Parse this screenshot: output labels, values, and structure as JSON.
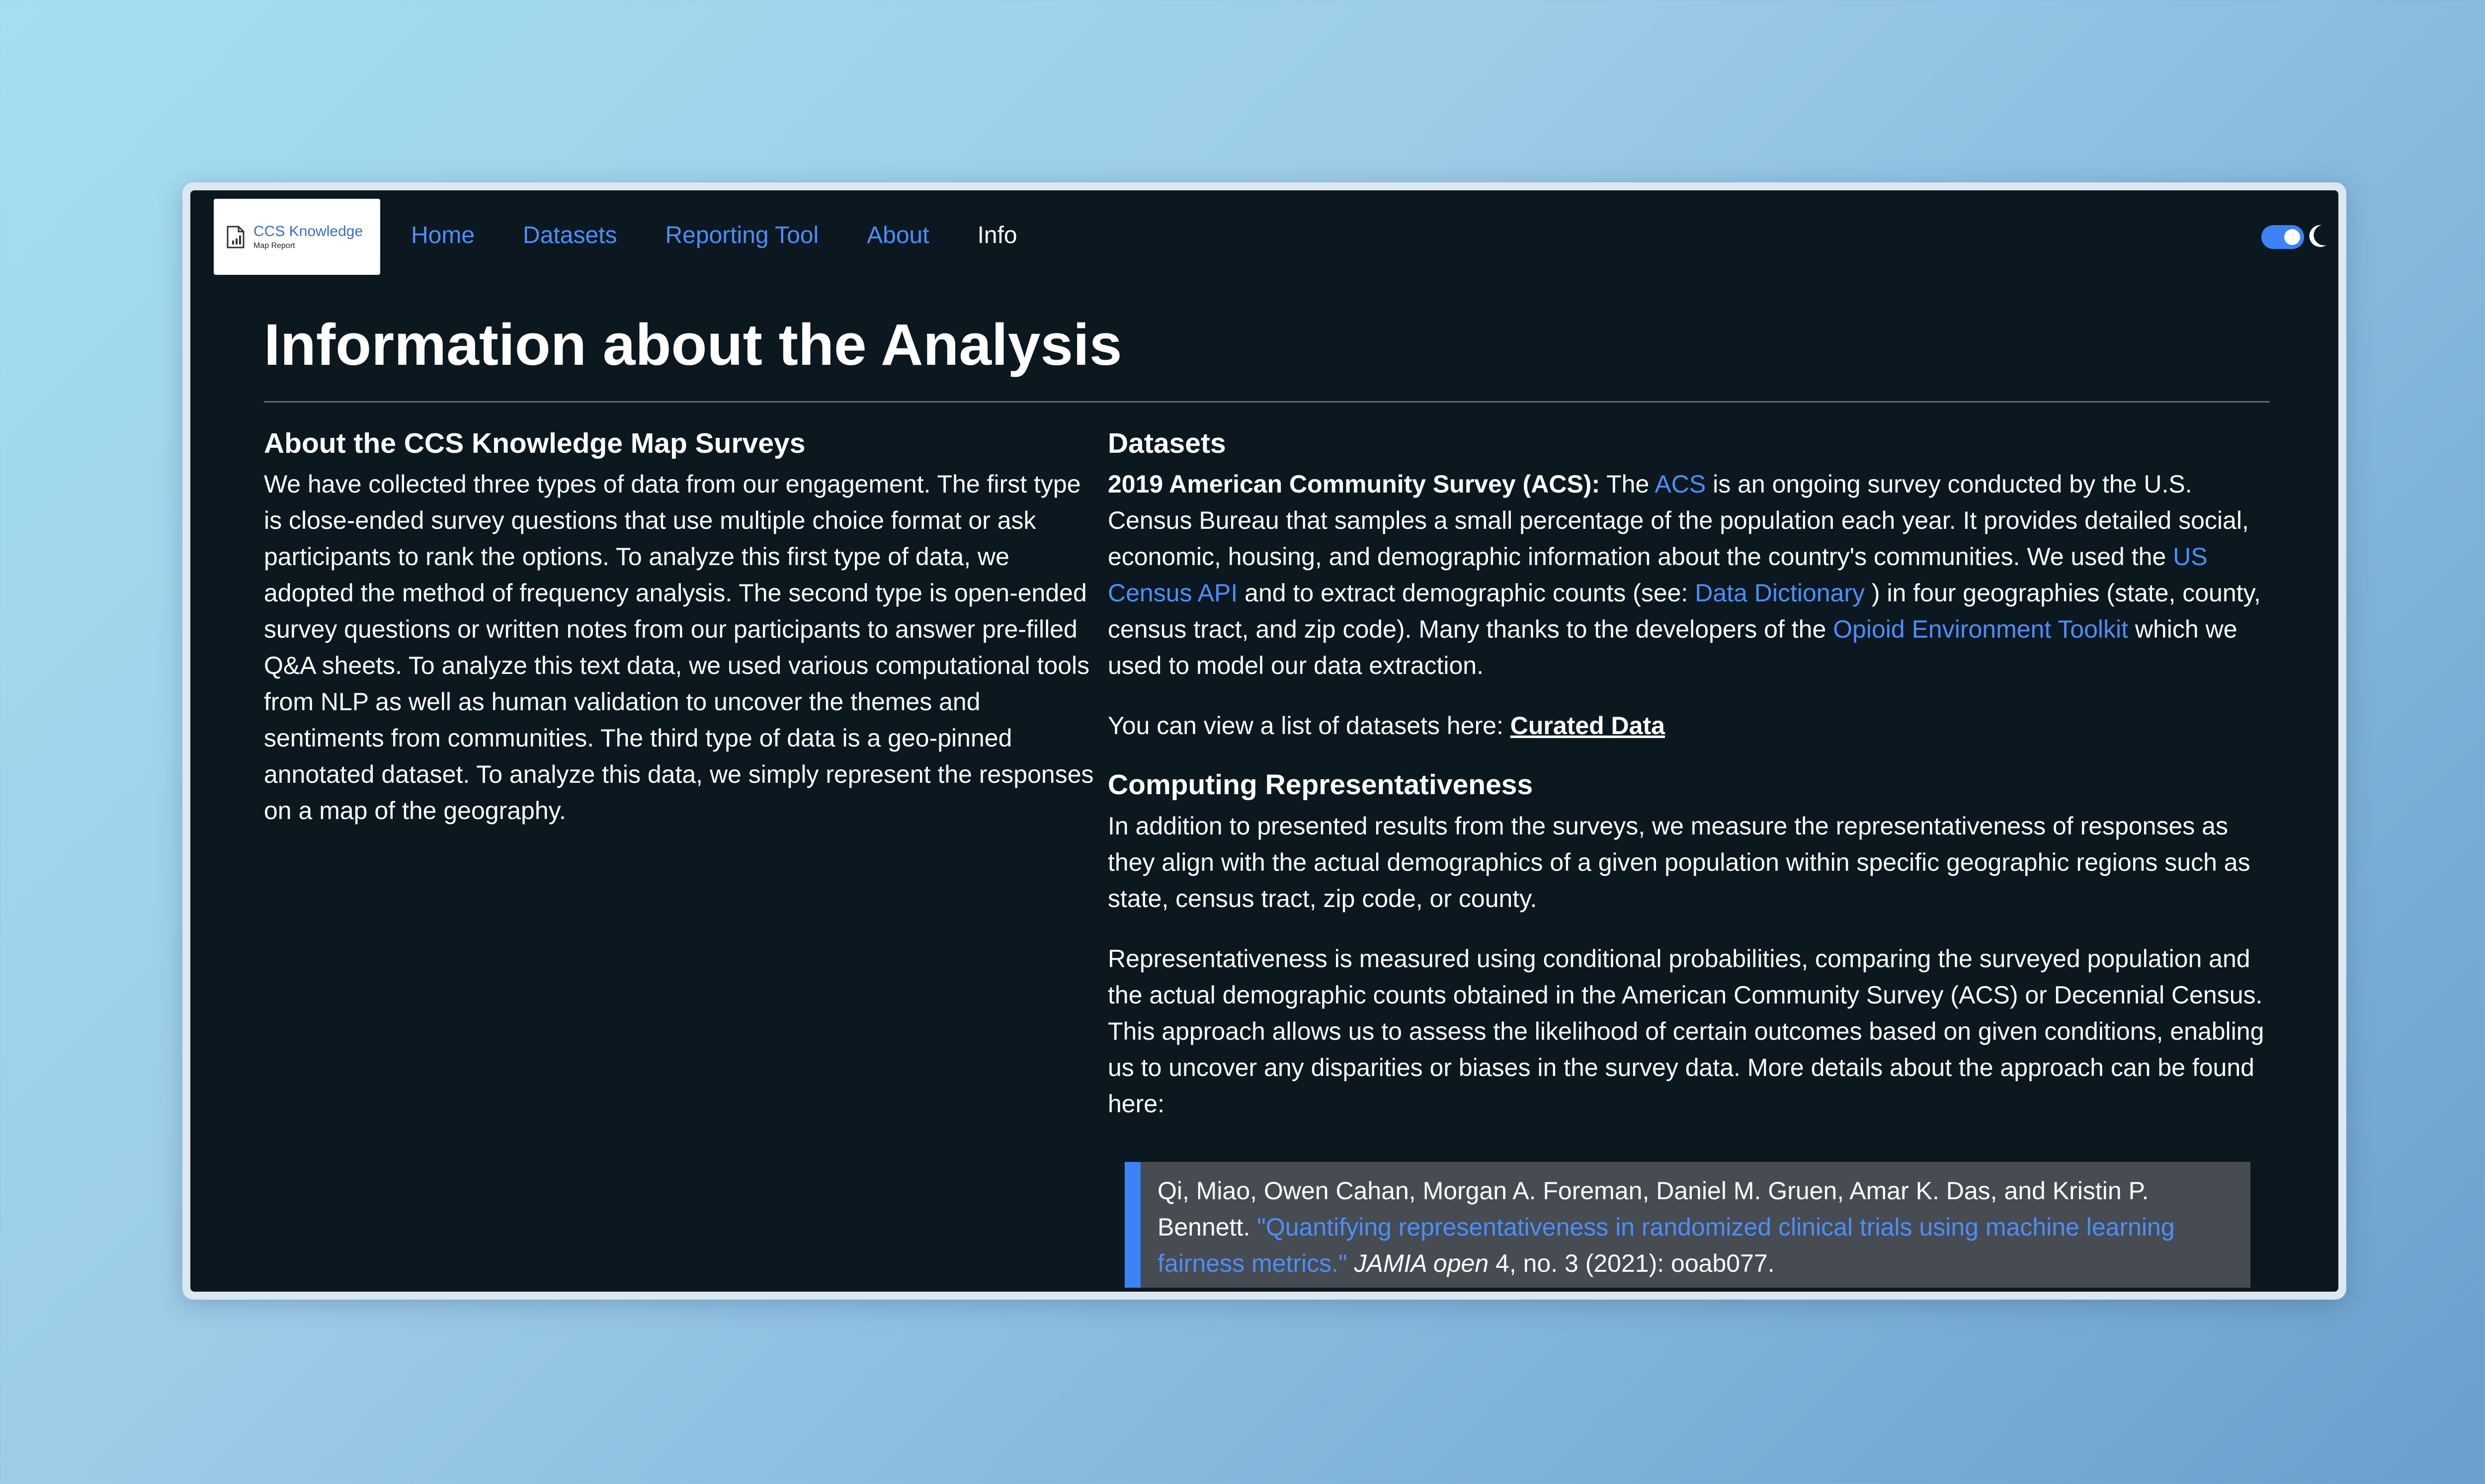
{
  "logo": {
    "title": "CCS Knowledge",
    "subtitle": "Map Report"
  },
  "nav": {
    "home": "Home",
    "datasets": "Datasets",
    "reporting_tool": "Reporting Tool",
    "about": "About",
    "info": "Info"
  },
  "colors": {
    "accent": "#4d8ef8",
    "background": "#0c1820",
    "quote_bg": "#474c52"
  },
  "theme_toggle": {
    "state": "on",
    "icon": "moon-icon"
  },
  "page": {
    "title": "Information about the Analysis"
  },
  "left": {
    "heading": "About the CCS Knowledge Map Surveys",
    "body": "We have collected three types of data from our engagement. The first type is close-ended survey questions that use multiple choice format or ask participants to rank the options. To analyze this first type of data, we adopted the method of frequency analysis. The second type is open-ended survey questions or written notes from our participants to answer pre-filled Q&A sheets. To analyze this text data, we used various computational tools from NLP as well as human validation to uncover the themes and sentiments from communities. The third type of data is a geo-pinned annotated dataset. To analyze this data, we simply represent the responses on a map of the geography."
  },
  "right": {
    "heading": "Datasets",
    "acs": {
      "label": "2019 American Community Survey (ACS):",
      "t1": " The ",
      "acs_link": "ACS",
      "t2": " is an ongoing survey conducted by the U.S. Census Bureau that samples a small percentage of the population each year. It provides detailed social, economic, housing, and demographic information about the country's communities. We used the ",
      "api_link": "US Census API",
      "t3": " and to extract demographic counts (see: ",
      "dict_link": "Data Dictionary",
      "t4": " ) in four geographies (state, county, census tract, and zip code). Many thanks to the developers of the ",
      "toolkit_link": "Opioid Environment Toolkit",
      "t5": " which we used to model our data extraction."
    },
    "curated": {
      "text": "You can view a list of datasets here: ",
      "link": "Curated Data"
    },
    "computing": {
      "heading": "Computing Representativeness",
      "p1": "In addition to presented results from the surveys, we measure the representativeness of responses as they align with the actual demographics of a given population within specific geographic regions such as state, census tract, zip code, or county.",
      "p2": "Representativeness is measured using conditional probabilities, comparing the surveyed population and the actual demographic counts obtained in the American Community Survey (ACS) or Decennial Census. This approach allows us to assess the likelihood of certain outcomes based on given conditions, enabling us to uncover any disparities or biases in the survey data. More details about the approach can be found here:"
    },
    "citation": {
      "authors": "Qi, Miao, Owen Cahan, Morgan A. Foreman, Daniel M. Gruen, Amar K. Das, and Kristin P. Bennett. ",
      "title_link": "\"Quantifying representativeness in randomized clinical trials using machine learning fairness metrics.\"",
      "journal": "JAMIA open",
      "rest": " 4, no. 3 (2021): ooab077."
    }
  }
}
